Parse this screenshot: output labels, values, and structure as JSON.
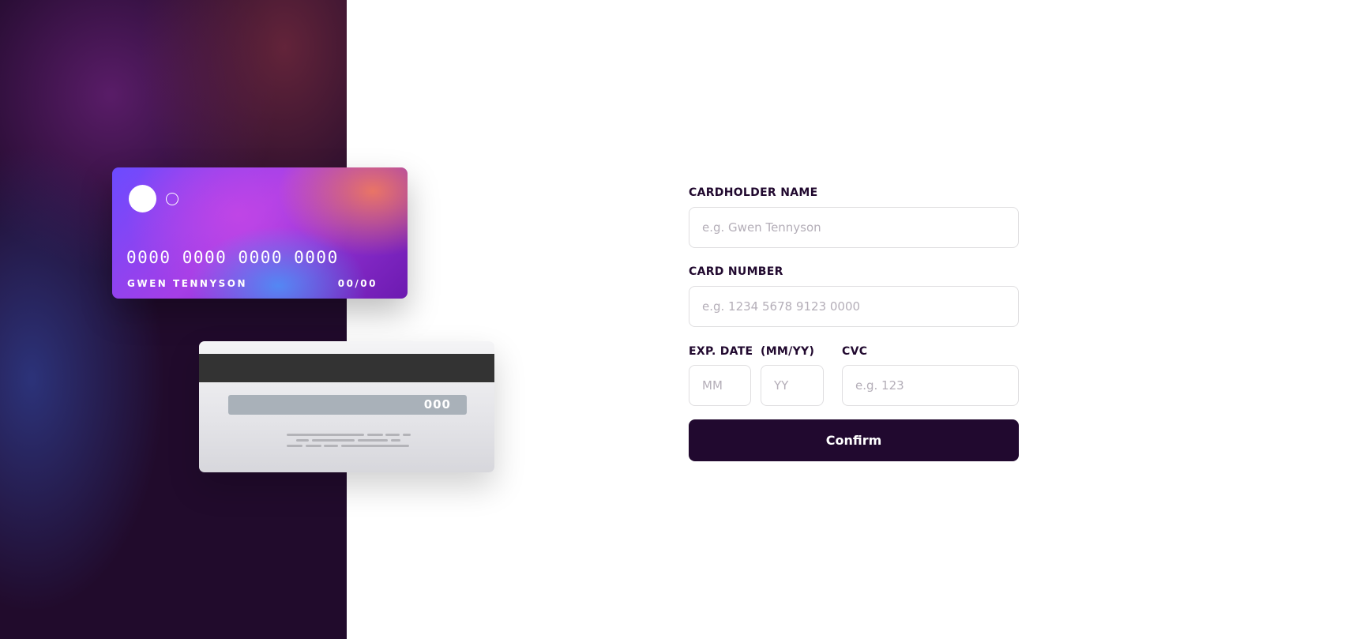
{
  "colors": {
    "accent_dark": "#21092f",
    "border": "#dfdee0",
    "placeholder": "#b4aeb8",
    "white": "#ffffff"
  },
  "card_front": {
    "number": "0000 0000 0000 0000",
    "holder_name": "GWEN TENNYSON",
    "expiry": "00/00"
  },
  "card_back": {
    "cvc": "000"
  },
  "form": {
    "cardholder_label": "CARDHOLDER NAME",
    "cardholder_placeholder": "e.g. Gwen Tennyson",
    "card_number_label": "CARD NUMBER",
    "card_number_placeholder": "e.g. 1234 5678 9123 0000",
    "exp_date_label": "EXP. DATE",
    "exp_format_label": "(MM/YY)",
    "month_placeholder": "MM",
    "year_placeholder": "YY",
    "cvc_label": "CVC",
    "cvc_placeholder": "e.g. 123",
    "confirm_label": "Confirm"
  }
}
